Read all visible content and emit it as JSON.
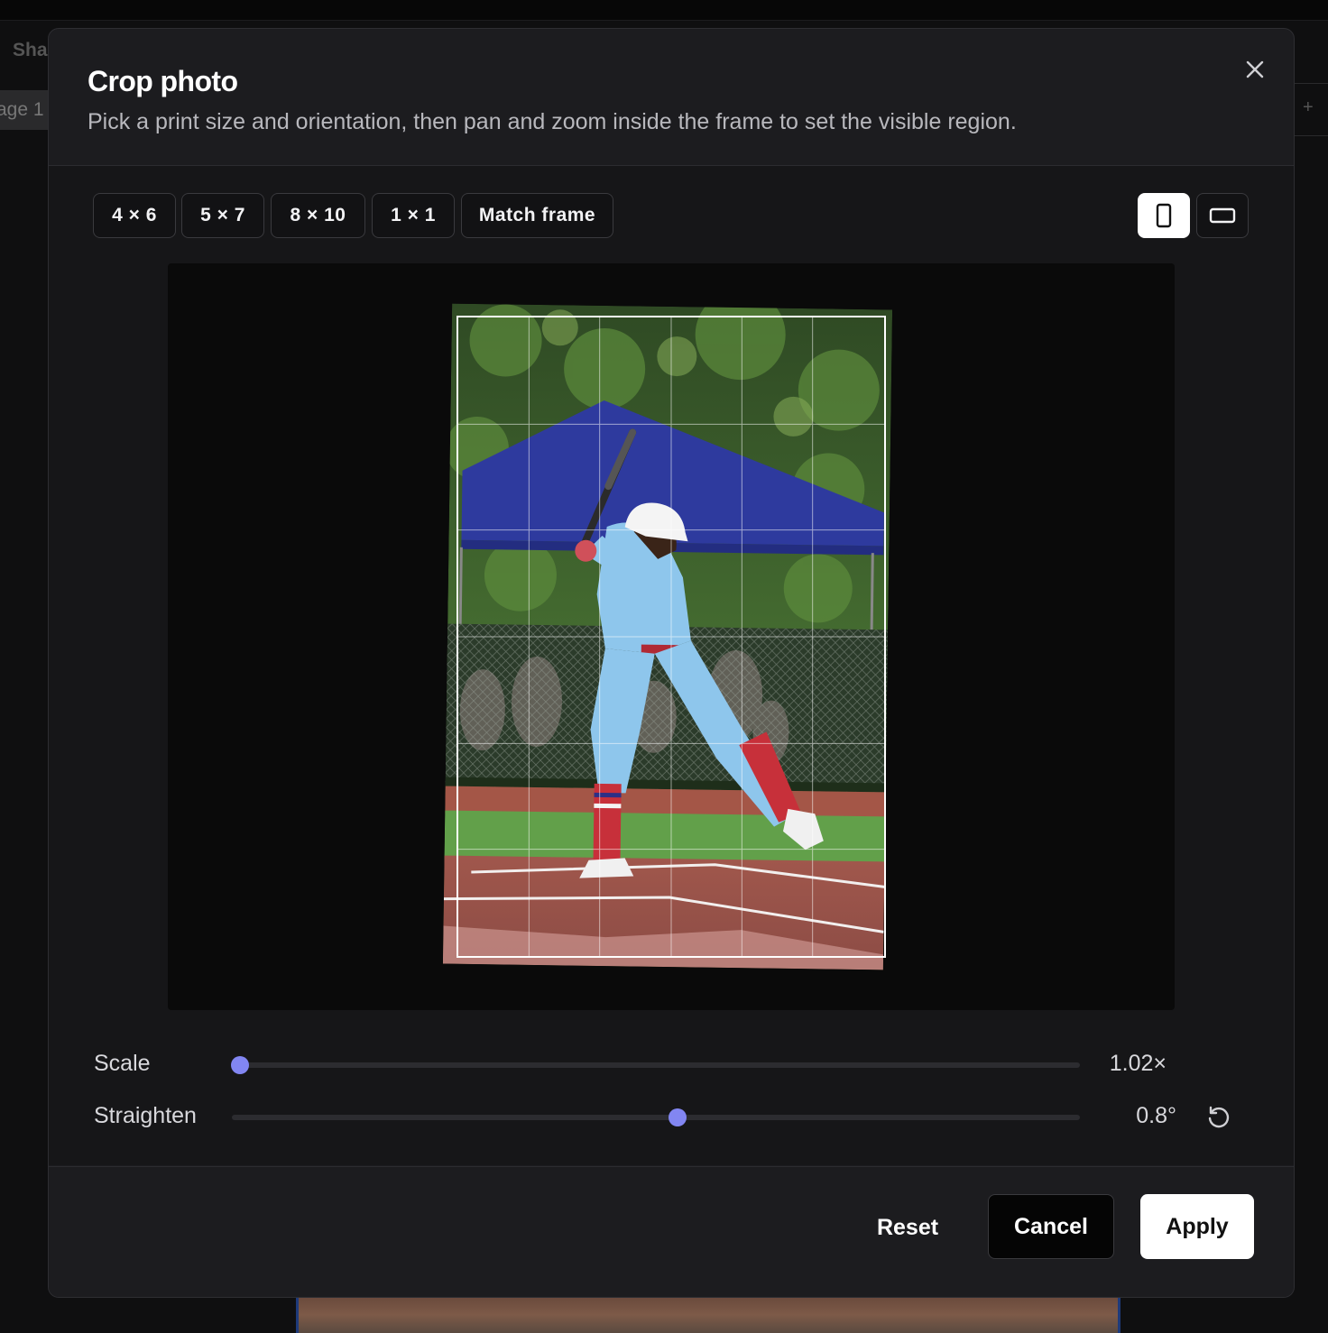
{
  "background": {
    "share_label": "Sha",
    "page_tab_label": "age 1",
    "add_label": "+"
  },
  "modal": {
    "title": "Crop photo",
    "description": "Pick a print size and orientation, then pan and zoom inside the frame to set the visible region.",
    "close_icon": "close-icon"
  },
  "print_sizes": [
    {
      "label": "4 × 6",
      "active": true
    },
    {
      "label": "5 × 7",
      "active": false
    },
    {
      "label": "8 × 10",
      "active": false
    },
    {
      "label": "1 × 1",
      "active": false
    },
    {
      "label": "Match frame",
      "active": false
    }
  ],
  "orientation": {
    "portrait_icon": "portrait-orientation-icon",
    "landscape_icon": "landscape-orientation-icon",
    "selected": "portrait"
  },
  "controls": {
    "scale": {
      "label": "Scale",
      "value_text": "1.02×",
      "fraction": 0.01
    },
    "straighten": {
      "label": "Straighten",
      "value_text": "0.8°",
      "fraction": 0.525,
      "reset_icon": "rotate-reset-icon"
    }
  },
  "footer": {
    "reset_label": "Reset",
    "cancel_label": "Cancel",
    "apply_label": "Apply"
  },
  "colors": {
    "accent": "#8286f2",
    "canopy": "#2e3a9e"
  }
}
